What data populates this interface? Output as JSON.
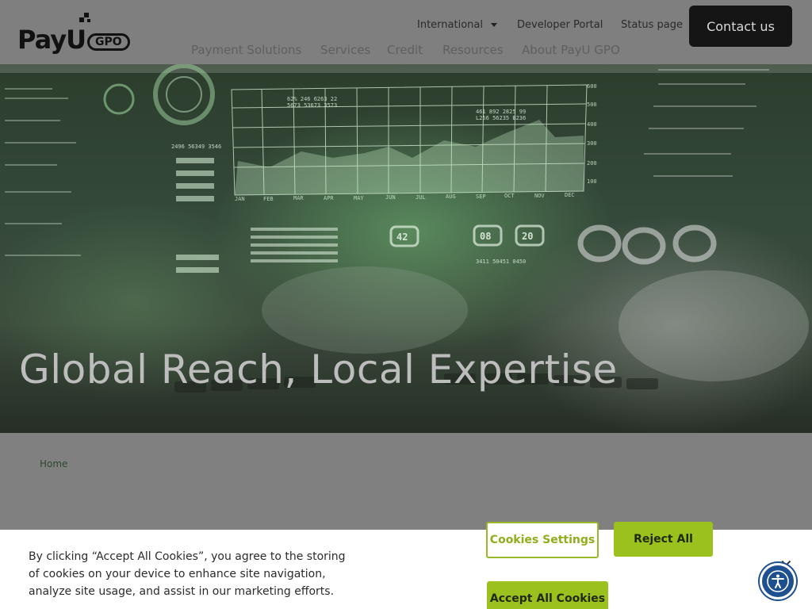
{
  "brand": {
    "logo_text": "PayU",
    "logo_badge": "GPO"
  },
  "utility_nav": {
    "international": "International",
    "developer_portal": "Developer Portal",
    "status_page": "Status page"
  },
  "contact_button": "Contact us",
  "main_nav": [
    "Payment Solutions",
    "Services",
    "Credit",
    "Resources",
    "About PayU GPO"
  ],
  "hero": {
    "title": "Global Reach, Local Expertise",
    "chart_readouts": [
      "62% 246 6263 22",
      "5673 53673 3573",
      "461 892 2825 99",
      "L256 56235 B236",
      "2496 56349 3546",
      "42",
      "08",
      "20",
      "3411 50451 0450"
    ],
    "chart_axis": [
      "600",
      "500",
      "400",
      "300",
      "200",
      "100"
    ],
    "chart_months": [
      "JAN",
      "FEB",
      "MAR",
      "APR",
      "MAY",
      "JUN",
      "JUL",
      "AUG",
      "SEP",
      "OCT",
      "NOV",
      "DEC"
    ]
  },
  "breadcrumb": {
    "home": "Home"
  },
  "cookie_banner": {
    "text": "By clicking “Accept All Cookies”, you agree to the storing of cookies on your device to enhance site navigation, analyze site usage, and assist in our marketing efforts.",
    "settings_label": "Cookies Settings",
    "reject_label": "Reject All",
    "accept_label": "Accept All Cookies",
    "close_glyph": "✕"
  },
  "colors": {
    "accent_green": "#9ac11d",
    "overlay": "#7f7f7f",
    "accessibility_blue": "#1e4f8f"
  },
  "icons": [
    "chevron-down-icon",
    "close-icon",
    "accessibility-icon"
  ]
}
